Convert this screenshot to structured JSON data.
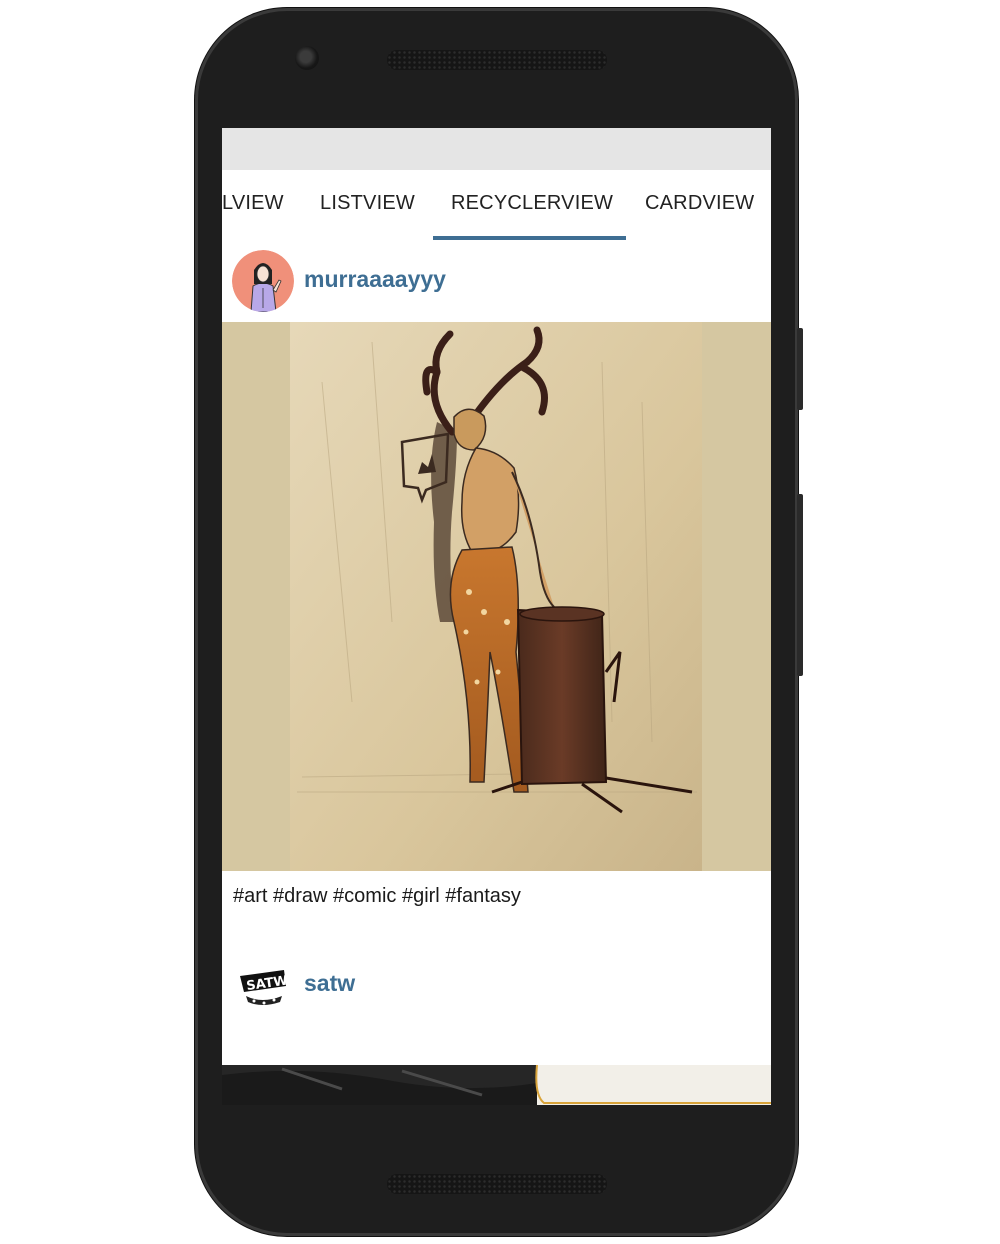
{
  "tabs": [
    "LVIEW",
    "LISTVIEW",
    "RECYCLERVIEW",
    "CARDVIEW"
  ],
  "active_tab": "RECYCLERVIEW",
  "posts": [
    {
      "username": "murraaaayyy",
      "caption": "#art #draw #comic #girl #fantasy"
    },
    {
      "username": "satw",
      "caption": ""
    }
  ],
  "colors": {
    "accent": "#3e6e93",
    "status_bar": "#e5e5e5",
    "device": "#1e1e1e"
  },
  "icons": {
    "avatar1": "avatar-illustrated-woman",
    "avatar2": "satw-logo-avatar",
    "camera": "front-camera-icon"
  }
}
